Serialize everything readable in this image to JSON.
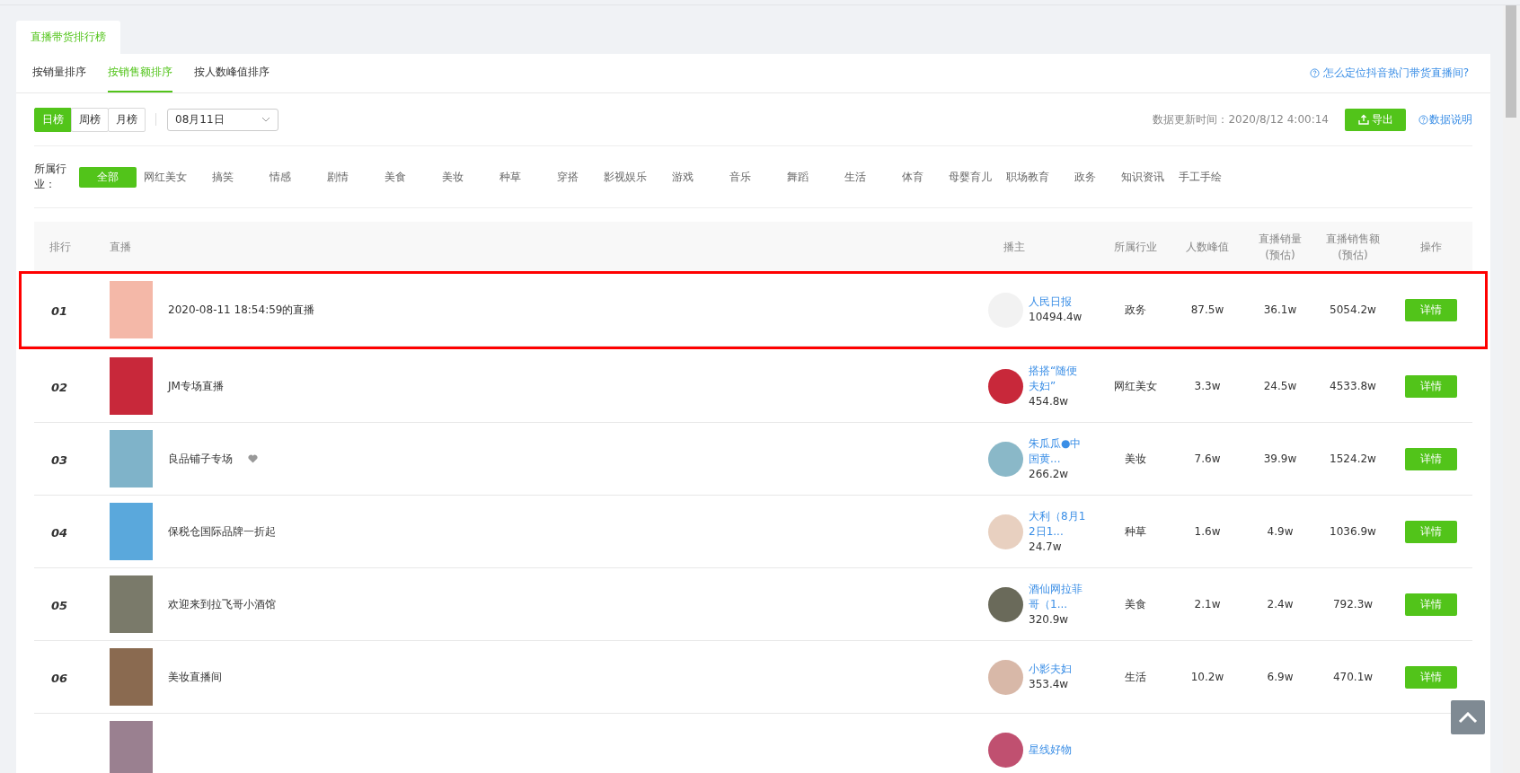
{
  "page_tab": "直播带货排行榜",
  "sort_tabs": [
    {
      "label": "按销量排序",
      "selected": false
    },
    {
      "label": "按销售额排序",
      "selected": true
    },
    {
      "label": "按人数峰值排序",
      "selected": false
    }
  ],
  "help_link": "怎么定位抖音热门带货直播间?",
  "periods": [
    {
      "label": "日榜",
      "selected": true
    },
    {
      "label": "周榜",
      "selected": false
    },
    {
      "label": "月榜",
      "selected": false
    }
  ],
  "date_select": {
    "value": "08月11日"
  },
  "update_time": "数据更新时间：2020/8/12 4:00:14",
  "export_button": "导出",
  "data_note_link": "数据说明",
  "industry_filter": {
    "label": "所属行业：",
    "items": [
      {
        "label": "全部",
        "selected": true
      },
      {
        "label": "网红美女",
        "selected": false
      },
      {
        "label": "搞笑",
        "selected": false
      },
      {
        "label": "情感",
        "selected": false
      },
      {
        "label": "剧情",
        "selected": false
      },
      {
        "label": "美食",
        "selected": false
      },
      {
        "label": "美妆",
        "selected": false
      },
      {
        "label": "种草",
        "selected": false
      },
      {
        "label": "穿搭",
        "selected": false
      },
      {
        "label": "影视娱乐",
        "selected": false
      },
      {
        "label": "游戏",
        "selected": false
      },
      {
        "label": "音乐",
        "selected": false
      },
      {
        "label": "舞蹈",
        "selected": false
      },
      {
        "label": "生活",
        "selected": false
      },
      {
        "label": "体育",
        "selected": false
      },
      {
        "label": "母婴育儿",
        "selected": false
      },
      {
        "label": "职场教育",
        "selected": false
      },
      {
        "label": "政务",
        "selected": false
      },
      {
        "label": "知识资讯",
        "selected": false
      },
      {
        "label": "手工手绘",
        "selected": false
      }
    ]
  },
  "table": {
    "columns": [
      "排行",
      "直播",
      "播主",
      "所属行业",
      "人数峰值",
      "直播销量(预估)",
      "直播销售额(预估)",
      "操作"
    ],
    "rows": [
      {
        "rank": "01",
        "title": "2020-08-11 18:54:59的直播",
        "favorited": false,
        "streamer": "人民日报",
        "fans": "10494.4w",
        "industry": "政务",
        "peak": "87.5w",
        "sales_volume": "36.1w",
        "sales_amount": "5054.2w",
        "action": "详情",
        "highlighted": true
      },
      {
        "rank": "02",
        "title": "JM专场直播",
        "favorited": false,
        "streamer": "搭搭“随便夫妇”",
        "fans": "454.8w",
        "industry": "网红美女",
        "peak": "3.3w",
        "sales_volume": "24.5w",
        "sales_amount": "4533.8w",
        "action": "详情",
        "highlighted": false
      },
      {
        "rank": "03",
        "title": "良品铺子专场",
        "favorited": true,
        "streamer": "朱瓜瓜●中国黄...",
        "fans": "266.2w",
        "industry": "美妆",
        "peak": "7.6w",
        "sales_volume": "39.9w",
        "sales_amount": "1524.2w",
        "action": "详情",
        "highlighted": false
      },
      {
        "rank": "04",
        "title": "保税仓国际品牌一折起",
        "favorited": false,
        "streamer": "大利（8月12日1...",
        "fans": "24.7w",
        "industry": "种草",
        "peak": "1.6w",
        "sales_volume": "4.9w",
        "sales_amount": "1036.9w",
        "action": "详情",
        "highlighted": false
      },
      {
        "rank": "05",
        "title": "欢迎来到拉飞哥小酒馆",
        "favorited": false,
        "streamer": "酒仙网拉菲哥（1...",
        "fans": "320.9w",
        "industry": "美食",
        "peak": "2.1w",
        "sales_volume": "2.4w",
        "sales_amount": "792.3w",
        "action": "详情",
        "highlighted": false
      },
      {
        "rank": "06",
        "title": "美妆直播间",
        "favorited": false,
        "streamer": "小影夫妇",
        "fans": "353.4w",
        "industry": "生活",
        "peak": "10.2w",
        "sales_volume": "6.9w",
        "sales_amount": "470.1w",
        "action": "详情",
        "highlighted": false
      },
      {
        "streamer": "星线好物",
        "favorited": false,
        "highlighted": false
      }
    ]
  }
}
